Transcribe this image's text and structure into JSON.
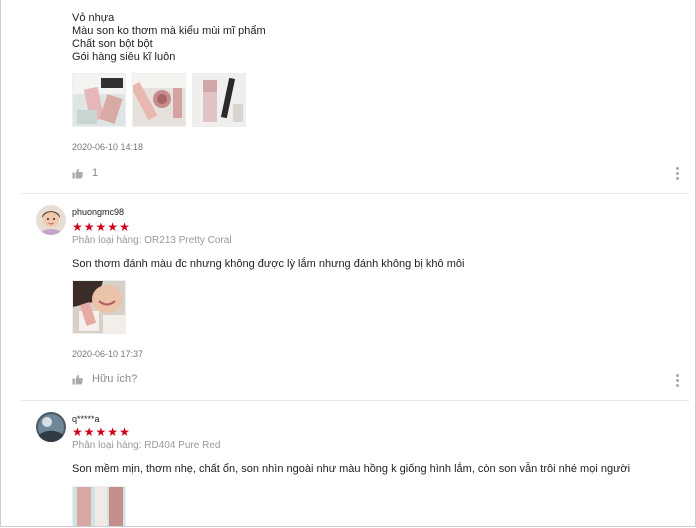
{
  "review1": {
    "lines": [
      "Vỏ nhựa",
      "Màu son ko thơm mà kiểu mùi mĩ phẩm",
      "Chất son bột bột",
      "Gói hàng siêu kĩ luôn"
    ],
    "time": "2020-06-10 14:18",
    "likes": "1"
  },
  "review2": {
    "username": "phuongmc98",
    "stars": [
      "★",
      "★",
      "★",
      "★",
      "★"
    ],
    "variant": "Phân loại hàng: OR213 Pretty Coral",
    "comment": "Son thơm đánh màu đc nhưng không được lỳ lắm nhưng đánh không bị khô môi",
    "time": "2020-06-10 17:37",
    "helpful": "Hữu ích?"
  },
  "review3": {
    "username": "q*****a",
    "stars": [
      "★",
      "★",
      "★",
      "★",
      "★"
    ],
    "variant": "Phân loại hàng: RD404 Pure Red",
    "comment": "Son mềm mịn,   thơm nhẹ,  chất ổn, son nhìn ngoài như màu hồng  k giống hình lắm,   còn son vẫn trôi nhé mọi người"
  },
  "icons": {
    "like": "thumbs-up-icon",
    "more": "more-vertical-icon",
    "star": "star-icon"
  },
  "colors": {
    "star": "#d0021b",
    "muted_text": "#999999",
    "divider": "#e8e8e8"
  }
}
